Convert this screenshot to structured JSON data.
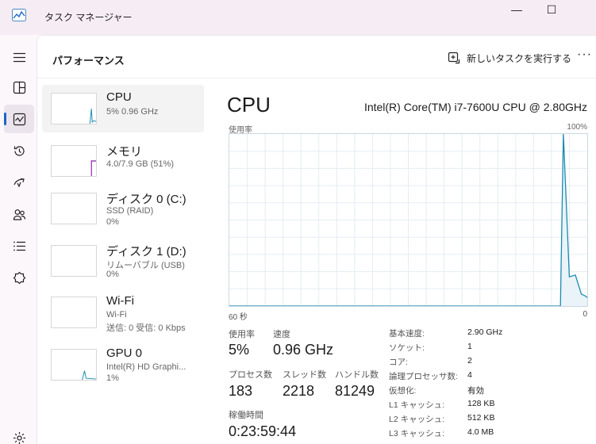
{
  "window": {
    "title": "タスク マネージャー",
    "minimize_glyph": "—",
    "maximize_glyph": "☐"
  },
  "nav": {
    "items": [
      {
        "icon": "hamburger-menu-icon"
      },
      {
        "icon": "processes-icon"
      },
      {
        "icon": "performance-icon",
        "active": true
      },
      {
        "icon": "app-history-icon"
      },
      {
        "icon": "startup-apps-icon"
      },
      {
        "icon": "users-icon"
      },
      {
        "icon": "details-icon"
      },
      {
        "icon": "services-icon"
      },
      {
        "icon": "settings-icon"
      }
    ]
  },
  "header": {
    "title": "パフォーマンス",
    "new_task_label": "新しいタスクを実行する",
    "more_label": "···"
  },
  "devices": [
    {
      "name": "CPU",
      "line1": "5%  0.96 GHz",
      "line2": "",
      "color": "#1b8bb0",
      "selected": true
    },
    {
      "name": "メモリ",
      "line1": "4.0/7.9 GB (51%)",
      "line2": "",
      "color": "#8b1fa3",
      "selected": false
    },
    {
      "name": "ディスク 0 (C:)",
      "line1": "SSD (RAID)",
      "line2": "0%",
      "color": "#4c9a2a",
      "selected": false
    },
    {
      "name": "ディスク 1 (D:)",
      "line1": "リムーバブル (USB)",
      "line2": "0%",
      "color": "#4c9a2a",
      "selected": false
    },
    {
      "name": "Wi-Fi",
      "line1": "Wi-Fi",
      "line2": "送信: 0 受信: 0 Kbps",
      "color": "#a7540a",
      "selected": false
    },
    {
      "name": "GPU 0",
      "line1": "Intel(R) HD Graphi...",
      "line2": "1%",
      "color": "#1b8bb0",
      "selected": false
    }
  ],
  "detail": {
    "title": "CPU",
    "model": "Intel(R) Core(TM) i7-7600U CPU @ 2.80GHz",
    "graph_label": "使用率",
    "graph_max": "100%",
    "axis_left": "60 秒",
    "axis_right": "0",
    "line_color": "#1b8bb0",
    "fill_color": "#eaf3f8",
    "grid_color": "#e3edf3",
    "stats": {
      "usage_label": "使用率",
      "usage_value": "5%",
      "speed_label": "速度",
      "speed_value": "0.96 GHz",
      "processes_label": "プロセス数",
      "processes_value": "183",
      "threads_label": "スレッド数",
      "threads_value": "2218",
      "handles_label": "ハンドル数",
      "handles_value": "81249",
      "uptime_label": "稼働時間",
      "uptime_value": "0:23:59:44"
    },
    "specs": [
      {
        "label": "基本速度:",
        "value": "2.90 GHz"
      },
      {
        "label": "ソケット:",
        "value": "1"
      },
      {
        "label": "コア:",
        "value": "2"
      },
      {
        "label": "論理プロセッサ数:",
        "value": "4"
      },
      {
        "label": "仮想化:",
        "value": "有効"
      },
      {
        "label": "L1 キャッシュ:",
        "value": "128 KB"
      },
      {
        "label": "L2 キャッシュ:",
        "value": "512 KB"
      },
      {
        "label": "L3 キャッシュ:",
        "value": "4.0 MB"
      }
    ]
  },
  "chart_data": {
    "type": "line",
    "ylabel": "使用率",
    "ylim": [
      0,
      100
    ],
    "xlim": [
      60,
      0
    ],
    "x_tick_labels": [
      "60 秒",
      "0"
    ],
    "y_tick_labels": [
      "100%"
    ],
    "grid": true,
    "series": [
      {
        "x": [
          60,
          5,
          4.5,
          4,
          3,
          2,
          1,
          0.4,
          0
        ],
        "values": [
          0,
          0,
          0,
          100,
          17,
          18,
          7,
          6,
          5
        ]
      }
    ]
  }
}
